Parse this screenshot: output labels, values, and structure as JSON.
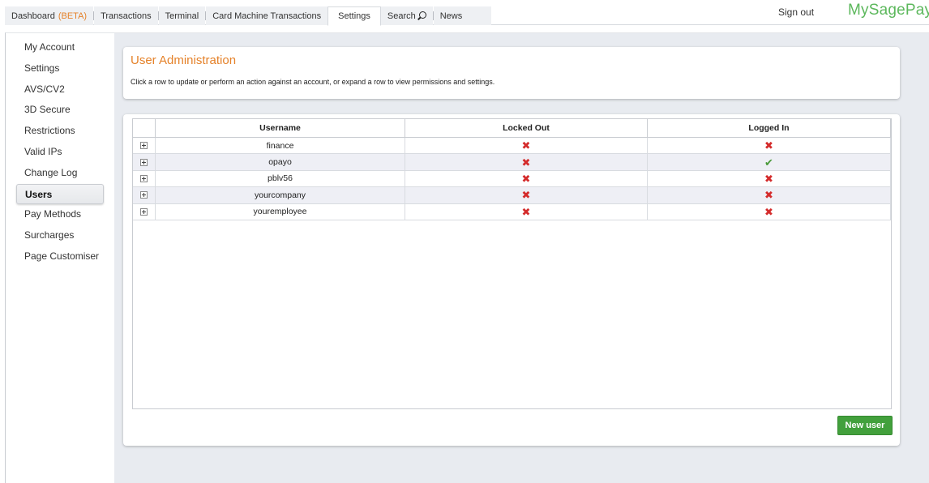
{
  "nav": {
    "tabs": [
      {
        "label": "Dashboard",
        "badge": "(BETA)"
      },
      {
        "label": "Transactions"
      },
      {
        "label": "Terminal"
      },
      {
        "label": "Card Machine Transactions"
      },
      {
        "label": "Settings"
      },
      {
        "label": "Search"
      },
      {
        "label": "News"
      }
    ],
    "active_tab": "Settings",
    "signout": "Sign out",
    "brand": "MySagePay"
  },
  "sidebar": {
    "items": [
      {
        "label": "My Account"
      },
      {
        "label": "Settings"
      },
      {
        "label": "AVS/CV2"
      },
      {
        "label": "3D Secure"
      },
      {
        "label": "Restrictions"
      },
      {
        "label": "Valid IPs"
      },
      {
        "label": "Change Log"
      },
      {
        "label": "Users"
      },
      {
        "label": "Pay Methods"
      },
      {
        "label": "Surcharges"
      },
      {
        "label": "Page Customiser"
      }
    ],
    "active": "Users"
  },
  "page": {
    "title": "User Administration",
    "description": "Click a row to update or perform an action against an account, or expand a row to view permissions and settings."
  },
  "table": {
    "columns": [
      "Username",
      "Locked Out",
      "Logged In"
    ],
    "rows": [
      {
        "username": "finance",
        "locked_out": false,
        "logged_in": false
      },
      {
        "username": "opayo",
        "locked_out": false,
        "logged_in": true
      },
      {
        "username": "pblv56",
        "locked_out": false,
        "logged_in": false
      },
      {
        "username": "yourcompany",
        "locked_out": false,
        "logged_in": false
      },
      {
        "username": "youremployee",
        "locked_out": false,
        "logged_in": false
      }
    ]
  },
  "actions": {
    "new_user": "New user"
  },
  "icons": {
    "search": "search-icon",
    "expand": "expand-icon",
    "no": "cross-icon",
    "yes": "check-icon"
  },
  "colors": {
    "accent": "#e5822a",
    "brand": "#5cb85c",
    "button": "#42a03c",
    "cross": "#d42b2b",
    "check": "#4a9a3a"
  }
}
